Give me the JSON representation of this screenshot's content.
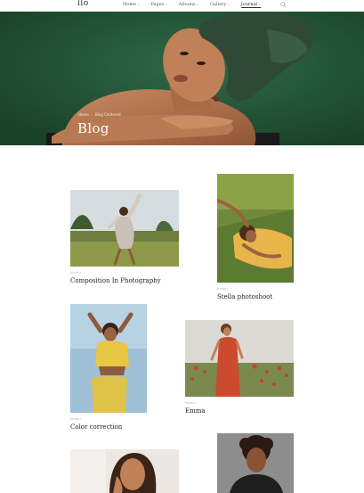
{
  "site": {
    "logo": "llo"
  },
  "nav": [
    {
      "label": "Home",
      "dropdown": true,
      "active": false
    },
    {
      "label": "Pages",
      "dropdown": true,
      "active": false
    },
    {
      "label": "Albums",
      "dropdown": true,
      "active": false
    },
    {
      "label": "Gallery",
      "dropdown": true,
      "active": false
    },
    {
      "label": "Journal",
      "dropdown": true,
      "active": true
    }
  ],
  "icons": {
    "search": "search-icon",
    "chevron": "chevron-down-icon"
  },
  "hero": {
    "breadcrumb": [
      "Home",
      "Blog Centered"
    ],
    "title": "Blog",
    "bg_color": "#255a3b"
  },
  "posts": [
    {
      "category": "Model",
      "title": "Composition In Photography"
    },
    {
      "category": "Model",
      "title": "Stella photoshoot"
    },
    {
      "category": "Model",
      "title": "Color correction"
    },
    {
      "category": "Model",
      "title": "Emma"
    },
    {
      "category": "",
      "title": ""
    },
    {
      "category": "",
      "title": ""
    }
  ]
}
